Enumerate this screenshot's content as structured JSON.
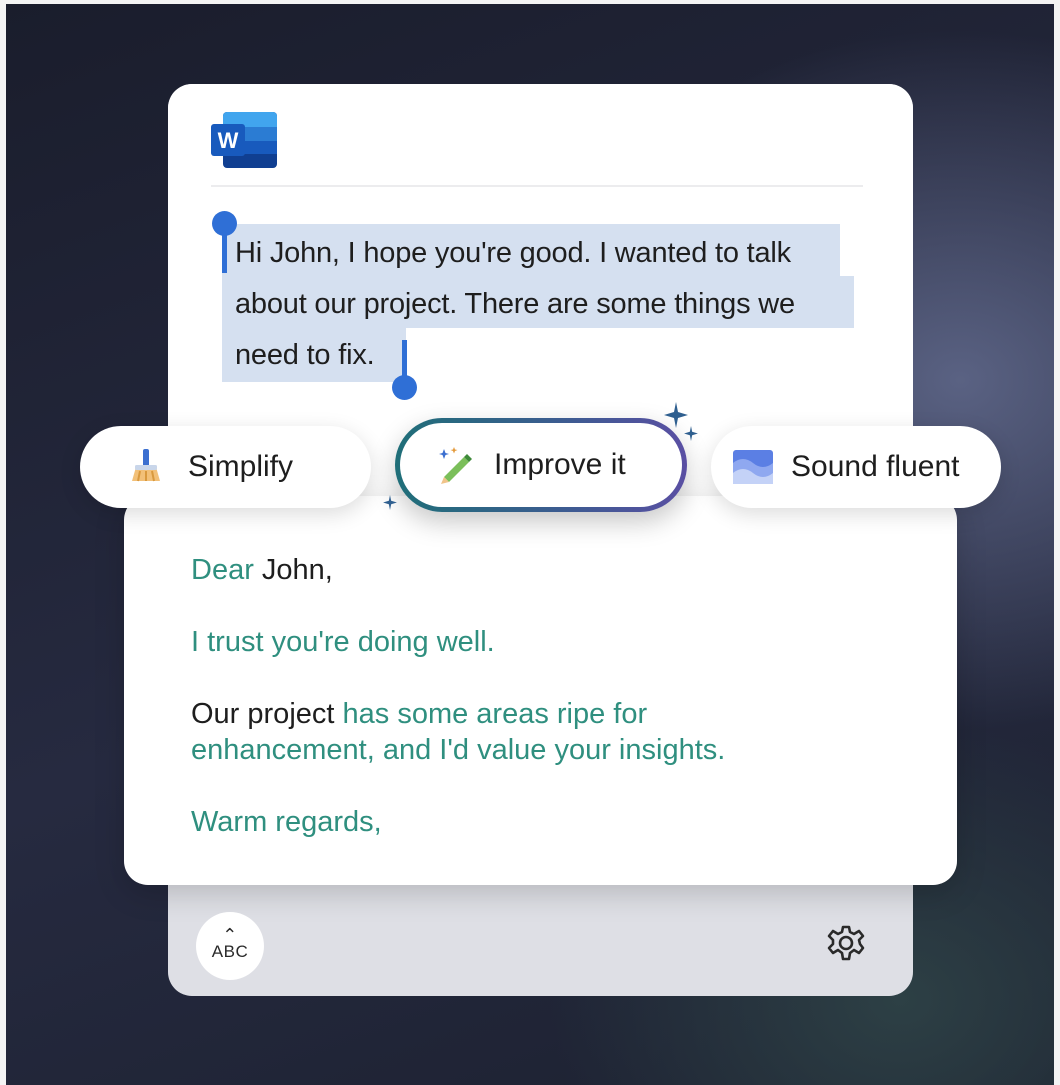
{
  "app": {
    "logo_letter": "W",
    "logo_icon": "word-icon"
  },
  "selection": {
    "lines": [
      "Hi John, I hope you're good. I wanted to talk",
      "about our project. There are some things we",
      "need to fix."
    ]
  },
  "actions": {
    "simplify": {
      "label": "Simplify",
      "icon": "broom-icon"
    },
    "improve": {
      "label": "Improve it",
      "icon": "magic-pencil-icon"
    },
    "fluent": {
      "label": "Sound fluent",
      "icon": "wave-icon"
    }
  },
  "result": {
    "greeting_changed": "Dear",
    "greeting_rest": " John,",
    "line2": "I trust you're doing well.",
    "line3_kept": "Our project ",
    "line3_changed_a": "has some areas ripe for",
    "line3_changed_b": "enhancement, and I'd value your insights.",
    "closing": "Warm regards,"
  },
  "toolbar": {
    "abc_caret": "⌃",
    "abc_label": "ABC",
    "settings_icon": "gear-icon"
  },
  "colors": {
    "accent_blue": "#2f6fd6",
    "suggestion_green": "#2f8f7f",
    "selection_bg": "#d5e0f0"
  }
}
